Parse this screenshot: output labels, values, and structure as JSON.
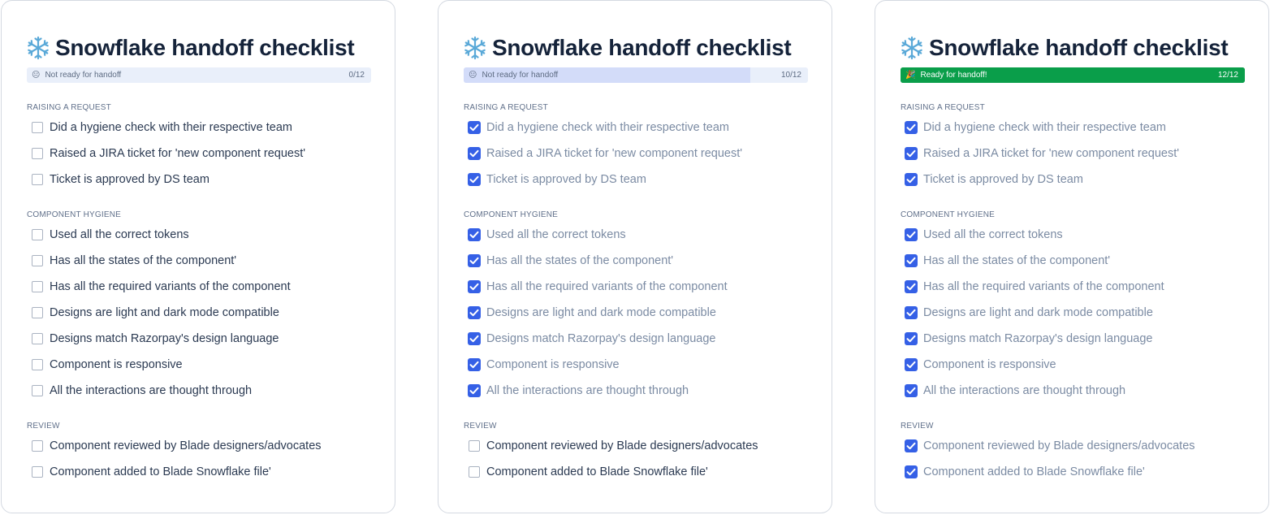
{
  "cards": [
    {
      "title": "Snowflake handoff checklist",
      "status_text": "Not ready for handoff",
      "status_emoji": "😐",
      "progress": 0,
      "count": "0/12",
      "ready": false,
      "sections": [
        {
          "heading": "RAISING A REQUEST",
          "items": [
            {
              "label": "Did a hygiene check with their respective team",
              "checked": false
            },
            {
              "label": "Raised a JIRA ticket for 'new component request'",
              "checked": false
            },
            {
              "label": "Ticket is approved by DS team",
              "checked": false
            }
          ]
        },
        {
          "heading": "COMPONENT HYGIENE",
          "items": [
            {
              "label": "Used all the correct tokens",
              "checked": false
            },
            {
              "label": "Has all the states of the component'",
              "checked": false
            },
            {
              "label": "Has all the required variants of the component",
              "checked": false
            },
            {
              "label": "Designs are light and dark mode compatible",
              "checked": false
            },
            {
              "label": "Designs match Razorpay's design language",
              "checked": false
            },
            {
              "label": "Component is responsive",
              "checked": false
            },
            {
              "label": "All the interactions are thought through",
              "checked": false
            }
          ]
        },
        {
          "heading": "REVIEW",
          "items": [
            {
              "label": "Component reviewed by Blade designers/advocates",
              "checked": false
            },
            {
              "label": "Component added to Blade Snowflake file'",
              "checked": false
            }
          ]
        }
      ]
    },
    {
      "title": "Snowflake handoff checklist",
      "status_text": "Not ready for handoff",
      "status_emoji": "😐",
      "progress": 0.833,
      "count": "10/12",
      "ready": false,
      "sections": [
        {
          "heading": "RAISING A REQUEST",
          "items": [
            {
              "label": "Did a hygiene check with their respective team",
              "checked": true
            },
            {
              "label": "Raised a JIRA ticket for 'new component request'",
              "checked": true
            },
            {
              "label": "Ticket is approved by DS team",
              "checked": true
            }
          ]
        },
        {
          "heading": "COMPONENT HYGIENE",
          "items": [
            {
              "label": "Used all the correct tokens",
              "checked": true
            },
            {
              "label": "Has all the states of the component'",
              "checked": true
            },
            {
              "label": "Has all the required variants of the component",
              "checked": true
            },
            {
              "label": "Designs are light and dark mode compatible",
              "checked": true
            },
            {
              "label": "Designs match Razorpay's design language",
              "checked": true
            },
            {
              "label": "Component is responsive",
              "checked": true
            },
            {
              "label": "All the interactions are thought through",
              "checked": true
            }
          ]
        },
        {
          "heading": "REVIEW",
          "items": [
            {
              "label": "Component reviewed by Blade designers/advocates",
              "checked": false
            },
            {
              "label": "Component added to Blade Snowflake file'",
              "checked": false
            }
          ]
        }
      ]
    },
    {
      "title": "Snowflake handoff checklist",
      "status_text": "Ready for handoff!",
      "status_emoji": "🎉",
      "progress": 1,
      "count": "12/12",
      "ready": true,
      "sections": [
        {
          "heading": "RAISING A REQUEST",
          "items": [
            {
              "label": "Did a hygiene check with their respective team",
              "checked": true
            },
            {
              "label": "Raised a JIRA ticket for 'new component request'",
              "checked": true
            },
            {
              "label": "Ticket is approved by DS team",
              "checked": true
            }
          ]
        },
        {
          "heading": "COMPONENT HYGIENE",
          "items": [
            {
              "label": "Used all the correct tokens",
              "checked": true
            },
            {
              "label": "Has all the states of the component'",
              "checked": true
            },
            {
              "label": "Has all the required variants of the component",
              "checked": true
            },
            {
              "label": "Designs are light and dark mode compatible",
              "checked": true
            },
            {
              "label": "Designs match Razorpay's design language",
              "checked": true
            },
            {
              "label": "Component is responsive",
              "checked": true
            },
            {
              "label": "All the interactions are thought through",
              "checked": true
            }
          ]
        },
        {
          "heading": "REVIEW",
          "items": [
            {
              "label": "Component reviewed by Blade designers/advocates",
              "checked": true
            },
            {
              "label": "Component added to Blade Snowflake file'",
              "checked": true
            }
          ]
        }
      ]
    }
  ],
  "colors": {
    "accent": "#3560e6",
    "progress_track": "#e9effa",
    "progress_fill": "#d3dcf9",
    "ready_green": "#0a9e4a",
    "title": "#15233a",
    "item_text": "#2b3a52",
    "item_text_checked": "#7b8ba3"
  },
  "icons": {
    "title_icon": "snowflake-icon",
    "checkbox_checked_icon": "checkmark-icon"
  }
}
